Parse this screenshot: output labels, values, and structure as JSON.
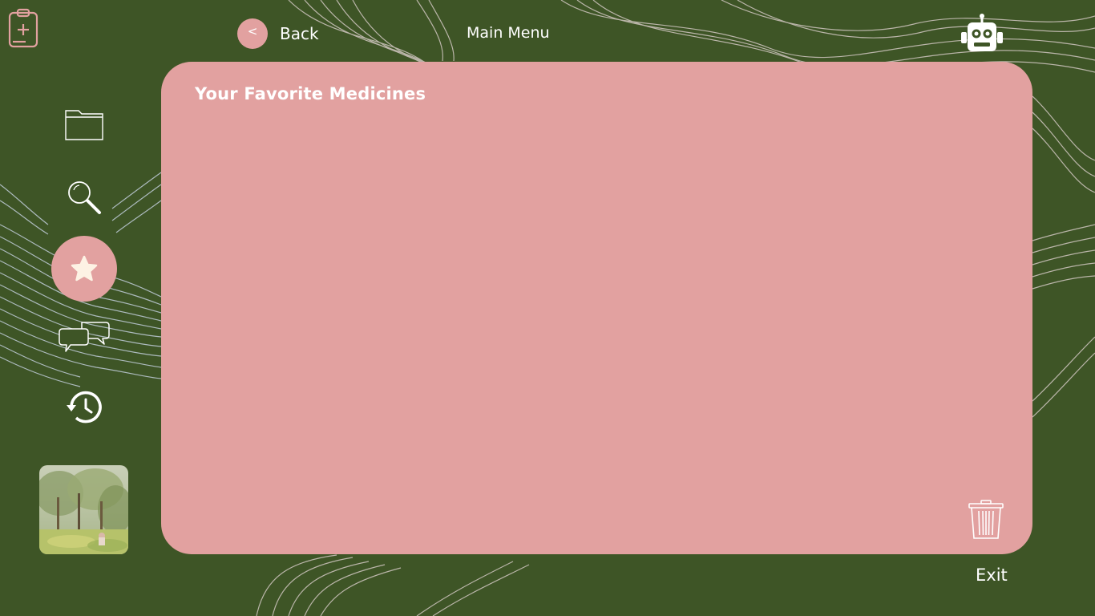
{
  "header": {
    "back_label": "Back",
    "back_glyph": "<",
    "main_menu_label": "Main Menu",
    "logo_icon": "clipboard-plus-icon",
    "assistant_icon": "robot-icon"
  },
  "sidebar": {
    "items": [
      {
        "name": "folder",
        "icon": "folder-icon",
        "active": false
      },
      {
        "name": "search",
        "icon": "search-icon",
        "active": false
      },
      {
        "name": "favorites",
        "icon": "star-icon",
        "active": true
      },
      {
        "name": "chat",
        "icon": "chat-bubbles-icon",
        "active": false
      },
      {
        "name": "history",
        "icon": "history-icon",
        "active": false
      }
    ]
  },
  "panel": {
    "title": "Your Favorite Medicines",
    "trash_icon": "trash-icon"
  },
  "footer": {
    "exit_label": "Exit"
  },
  "colors": {
    "background": "#3e5526",
    "accent": "#e2a1a0",
    "text": "#ffffff",
    "star": "#fdf2e4"
  }
}
